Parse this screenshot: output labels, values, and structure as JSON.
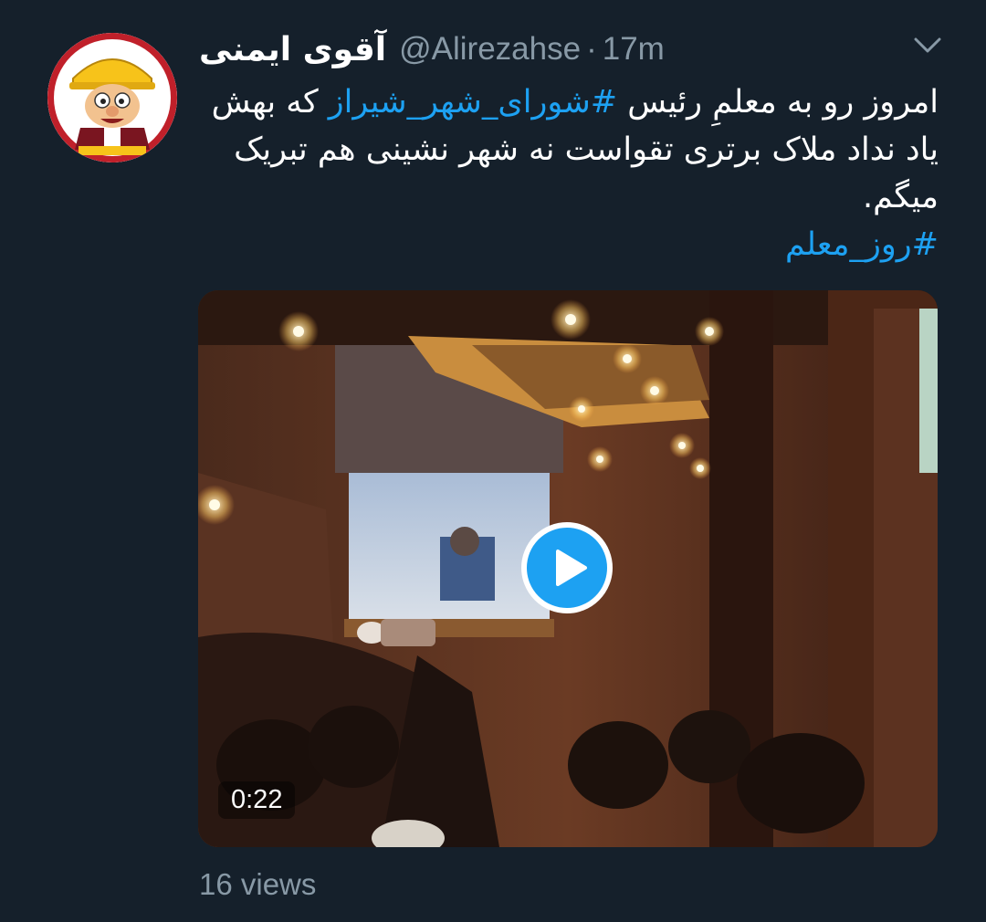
{
  "tweet": {
    "display_name": "آقوی ایمنی",
    "handle": "@Alirezahse",
    "separator": "·",
    "timestamp": "17m",
    "avatar_icon": "cartoon-hardhat-avatar",
    "menu_icon": "chevron-down-icon",
    "text_part_1": "امروز رو به معلمِ رئیس ",
    "hashtag_1": "#شورای_شهر_شیراز",
    "text_part_2": " که بهش یاد نداد ملاک برتری تقواست نه شهر نشینی هم تبریک میگم.",
    "hashtag_2": "#روز_معلم"
  },
  "media": {
    "type": "video",
    "play_icon": "play-icon",
    "duration": "0:22"
  },
  "footer": {
    "views": "16 views"
  },
  "colors": {
    "background": "#15202b",
    "text": "#ffffff",
    "muted": "#8899a6",
    "accent": "#1da1f2"
  }
}
